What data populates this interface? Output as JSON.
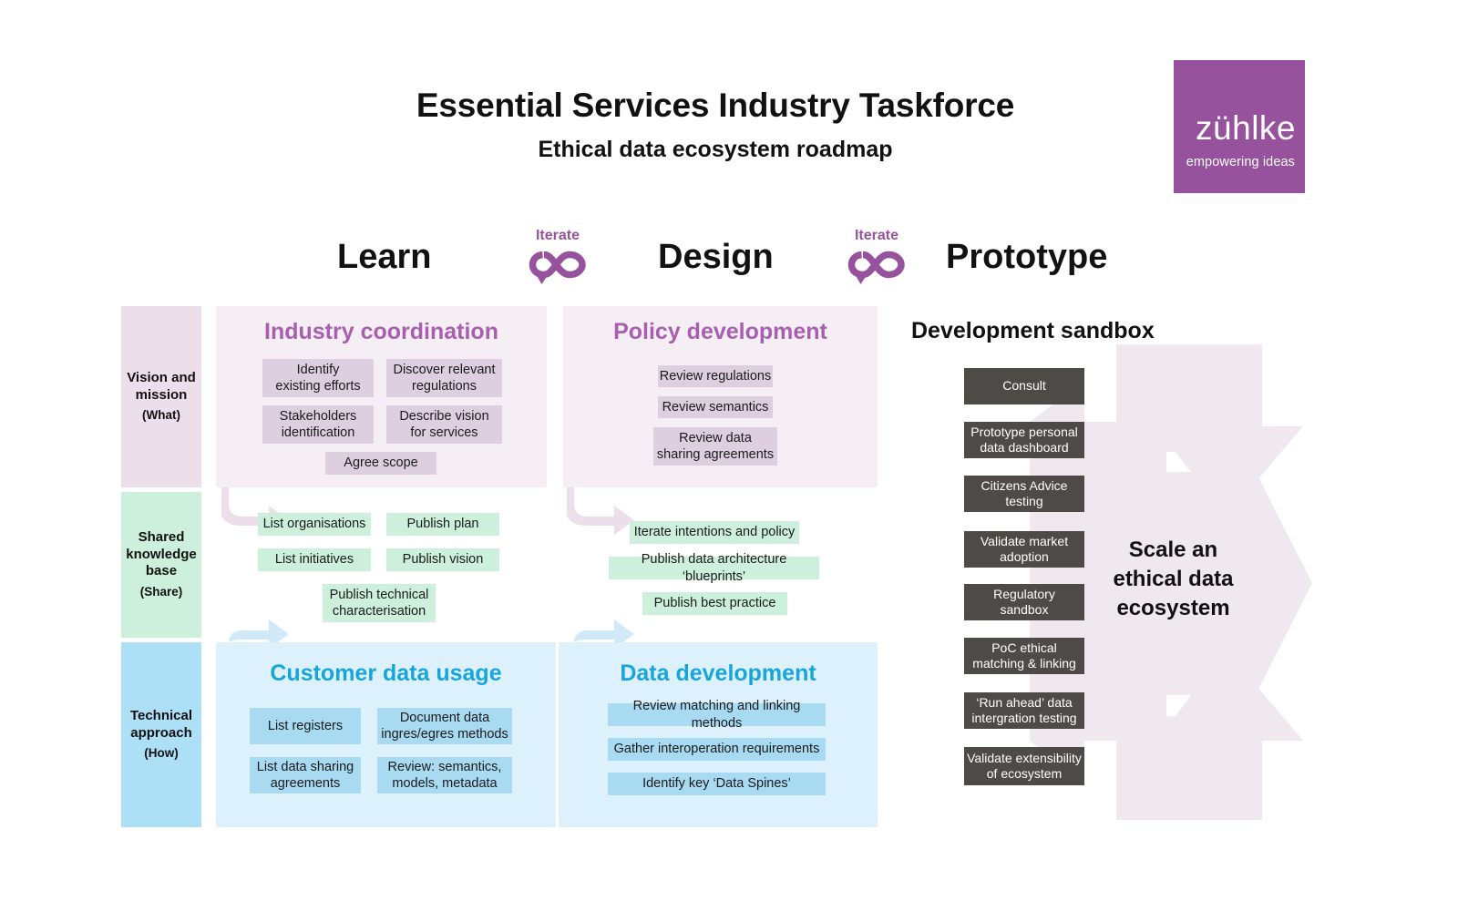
{
  "header": {
    "title": "Essential Services Industry Taskforce",
    "subtitle": "Ethical data ecosystem roadmap"
  },
  "logo": {
    "word": "zühlke",
    "tagline": "empowering ideas",
    "color": "#96529c"
  },
  "phases": [
    {
      "label": "Learn"
    },
    {
      "label": "Design"
    },
    {
      "label": "Prototype"
    }
  ],
  "iterate": {
    "label": "Iterate",
    "icon": "infinity-loop-icon",
    "color": "#96529c"
  },
  "rows": [
    {
      "title": "Vision and\nmission",
      "line1": "Vision and",
      "line2": "mission",
      "sub": "(What)",
      "color": "#eddeeb"
    },
    {
      "title": "Shared knowledge base",
      "line1": "Shared",
      "line2": "knowledge",
      "line3": "base",
      "sub": "(Share)",
      "color": "#cdf0dd"
    },
    {
      "title": "Technical approach",
      "line1": "Technical",
      "line2": "approach",
      "sub": "(How)",
      "color": "#ade0f7"
    }
  ],
  "panels": {
    "industry": {
      "title": "Industry coordination",
      "accent": "#a75fae",
      "items": [
        "Identify\nexisting efforts",
        "Discover relevant\nregulations",
        "Stakeholders\nidentification",
        "Describe vision\nfor services",
        "Agree scope"
      ],
      "items_flat": [
        "Identify existing efforts",
        "Discover relevant regulations",
        "Stakeholders identification",
        "Describe vision for services",
        "Agree scope"
      ]
    },
    "policy": {
      "title": "Policy development",
      "accent": "#a75fae",
      "items_flat": [
        "Review regulations",
        "Review semantics",
        "Review data sharing agreements"
      ]
    },
    "customer": {
      "title": "Customer data usage",
      "accent": "#18a5dc",
      "items_flat": [
        "List registers",
        "Document data ingres/egres methods",
        "List data sharing agreements",
        "Review: semantics, models, metadata"
      ]
    },
    "data": {
      "title": "Data development",
      "accent": "#18a5dc",
      "items_flat": [
        "Review matching and linking methods",
        "Gather interoperation requirements",
        "Identify key ‘Data Spines’"
      ]
    }
  },
  "shared_row": {
    "learn_items": [
      "List organisations",
      "Publish plan",
      "List initiatives",
      "Publish vision",
      "Publish technical characterisation"
    ],
    "design_items": [
      "Iterate intentions and policy",
      "Publish data architecture ‘blueprints’",
      "Publish best practice"
    ]
  },
  "sandbox": {
    "title": "Development sandbox",
    "chip_color": "#4e4a47",
    "items": [
      "Consult",
      "Prototype personal data dashboard",
      "Citizens Advice testing",
      "Validate market adoption",
      "Regulatory sandbox",
      "PoC ethical matching & linking",
      "‘Run ahead’ data intergration testing",
      "Validate extensibility of ecosystem"
    ]
  },
  "outcome": {
    "text": "Scale an ethical data ecosystem",
    "line1": "Scale an",
    "line2": "ethical data",
    "line3": "ecosystem",
    "arrow_color": "#efe8ef"
  },
  "chip_text": {
    "industry_1a": "Identify",
    "industry_1b": "existing efforts",
    "industry_2a": "Discover relevant",
    "industry_2b": "regulations",
    "industry_3a": "Stakeholders",
    "industry_3b": "identification",
    "industry_4a": "Describe vision",
    "industry_4b": "for services",
    "industry_5": "Agree scope",
    "policy_1": "Review regulations",
    "policy_2": "Review semantics",
    "policy_3a": "Review data",
    "policy_3b": "sharing agreements",
    "shared_learn_1": "List organisations",
    "shared_learn_2": "Publish plan",
    "shared_learn_3": "List initiatives",
    "shared_learn_4": "Publish vision",
    "shared_learn_5a": "Publish technical",
    "shared_learn_5b": "characterisation",
    "shared_design_1": "Iterate intentions and policy",
    "shared_design_2": "Publish data architecture ‘blueprints’",
    "shared_design_3": "Publish best practice",
    "customer_1": "List registers",
    "customer_2a": "Document data",
    "customer_2b": "ingres/egres methods",
    "customer_3a": "List data sharing",
    "customer_3b": "agreements",
    "customer_4a": "Review: semantics,",
    "customer_4b": "models, metadata",
    "data_1": "Review matching and linking methods",
    "data_2": "Gather interoperation requirements",
    "data_3": "Identify key ‘Data Spines’",
    "sandbox_1": "Consult",
    "sandbox_2a": "Prototype personal",
    "sandbox_2b": "data dashboard",
    "sandbox_3a": "Citizens Advice",
    "sandbox_3b": "testing",
    "sandbox_4a": "Validate market",
    "sandbox_4b": "adoption",
    "sandbox_5a": "Regulatory",
    "sandbox_5b": "sandbox",
    "sandbox_6a": "PoC ethical",
    "sandbox_6b": "matching & linking",
    "sandbox_7a": "‘Run ahead’ data",
    "sandbox_7b": "intergration testing",
    "sandbox_8a": "Validate extensibility",
    "sandbox_8b": "of ecosystem"
  }
}
